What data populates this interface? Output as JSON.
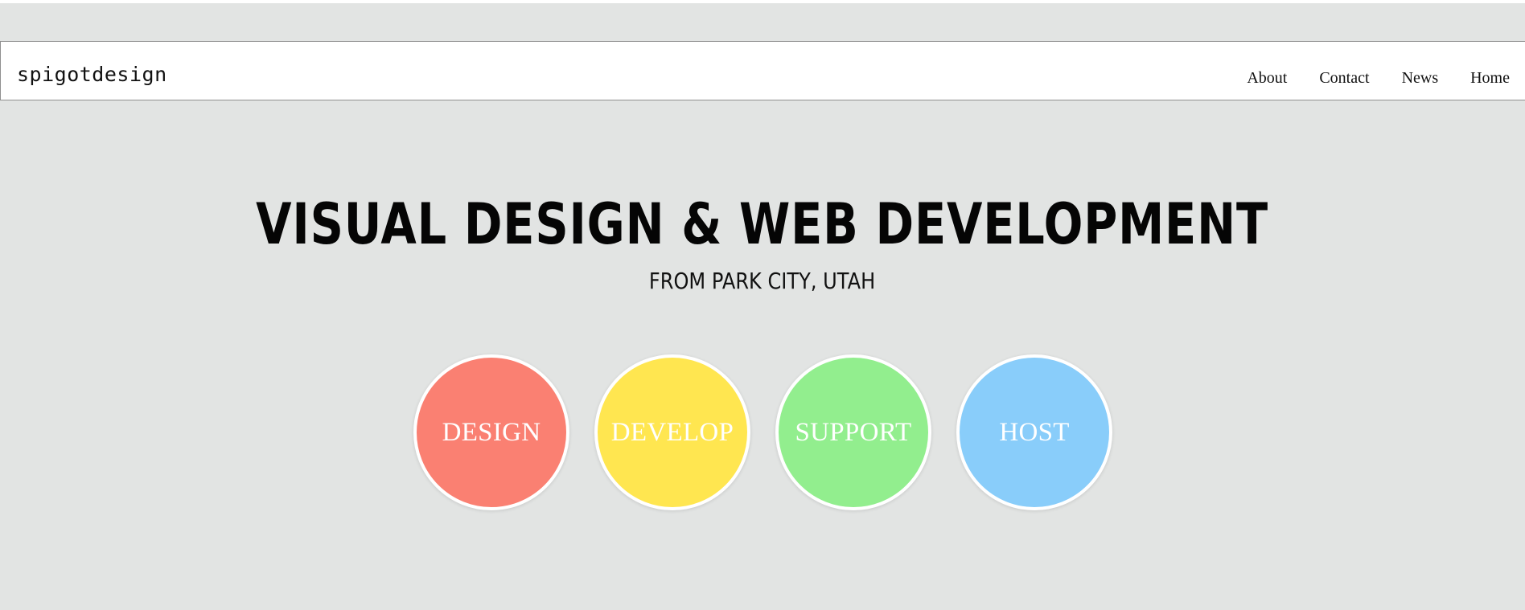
{
  "header": {
    "brand": "spigotdesign",
    "nav": [
      {
        "label": "About"
      },
      {
        "label": "Contact"
      },
      {
        "label": "News"
      },
      {
        "label": "Home"
      }
    ]
  },
  "hero": {
    "headline": "VISUAL DESIGN & WEB DEVELOPMENT",
    "subheadline": "FROM PARK CITY, UTAH"
  },
  "services": [
    {
      "label": "DESIGN",
      "color": "#fa8072"
    },
    {
      "label": "DEVELOP",
      "color": "#ffe650"
    },
    {
      "label": "SUPPORT",
      "color": "#92ee8e"
    },
    {
      "label": "HOST",
      "color": "#89cdfa"
    }
  ],
  "colors": {
    "background": "#e2e4e3",
    "navbar": "#ffffff",
    "text": "#111111"
  }
}
